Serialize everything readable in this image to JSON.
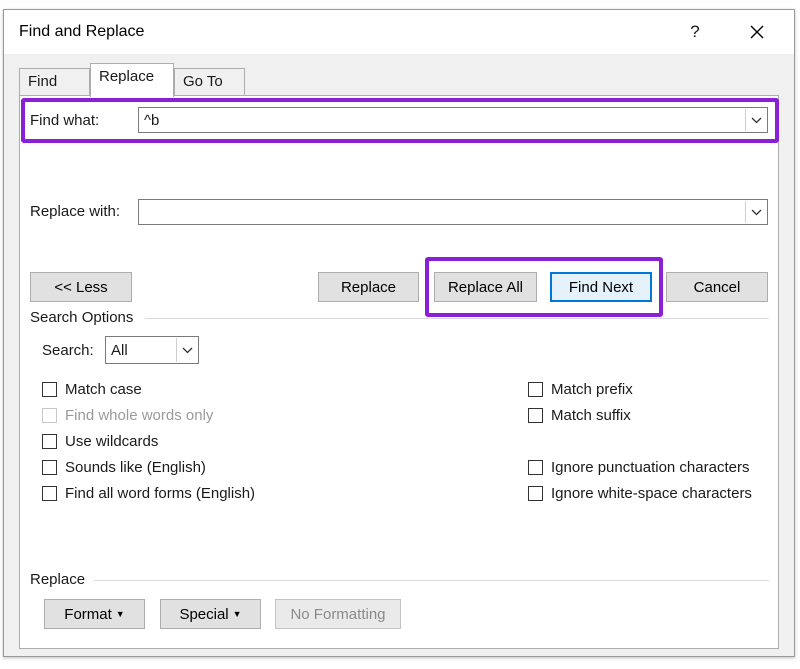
{
  "window": {
    "title": "Find and Replace",
    "help_label": "?",
    "close_label": "✕"
  },
  "tabs": [
    {
      "label": "Find",
      "active": false
    },
    {
      "label": "Replace",
      "active": true
    },
    {
      "label": "Go To",
      "active": false
    }
  ],
  "find": {
    "label": "Find what:",
    "value": "^b"
  },
  "replace_field": {
    "label": "Replace with:",
    "value": ""
  },
  "buttons": {
    "less": "<< Less",
    "replace": "Replace",
    "replace_all": "Replace All",
    "find_next": "Find Next",
    "cancel": "Cancel"
  },
  "search_options": {
    "title": "Search Options",
    "search_label": "Search:",
    "search_value": "All",
    "left_checks": [
      {
        "label": "Match case",
        "checked": false,
        "disabled": false
      },
      {
        "label": "Find whole words only",
        "checked": false,
        "disabled": true
      },
      {
        "label": "Use wildcards",
        "checked": false,
        "disabled": false
      },
      {
        "label": "Sounds like (English)",
        "checked": false,
        "disabled": false
      },
      {
        "label": "Find all word forms (English)",
        "checked": false,
        "disabled": false
      }
    ],
    "right_checks": [
      {
        "label": "Match prefix",
        "checked": false
      },
      {
        "label": "Match suffix",
        "checked": false
      },
      {
        "label": "Ignore punctuation characters",
        "checked": false
      },
      {
        "label": "Ignore white-space characters",
        "checked": false
      }
    ]
  },
  "replace_section": {
    "title": "Replace",
    "format": "Format",
    "special": "Special",
    "no_formatting": "No Formatting"
  },
  "colors": {
    "highlight": "#8b1fd6",
    "default_button_border": "#0078d7"
  }
}
